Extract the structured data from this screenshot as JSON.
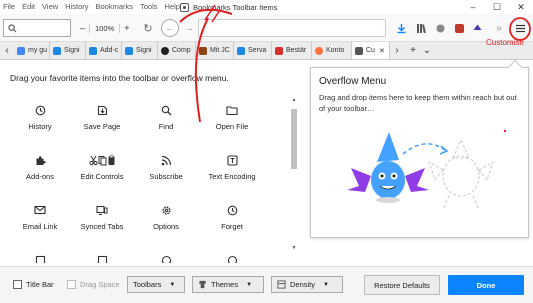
{
  "window": {
    "title": "Bookmarks Toolbar Items",
    "menu": [
      "File",
      "Edit",
      "View",
      "History",
      "Bookmarks",
      "Tools",
      "Help"
    ],
    "controls": [
      "–",
      "☐",
      "✕"
    ]
  },
  "toolbar": {
    "search_placeholder": "",
    "zoom_minus": "–",
    "zoom_value": "100%",
    "zoom_plus": "+",
    "reload": "↻"
  },
  "tabs": [
    {
      "label": "my gu",
      "color": "#4285f4"
    },
    {
      "label": "Signi",
      "color": "#1e88e5"
    },
    {
      "label": "Add-c",
      "color": "#1e88e5"
    },
    {
      "label": "Signi",
      "color": "#1e88e5"
    },
    {
      "label": "Comp",
      "color": "#222222"
    },
    {
      "label": "Mit JC",
      "color": "#8b4513"
    },
    {
      "label": "Serva",
      "color": "#1e88e5"
    },
    {
      "label": "Bestär",
      "color": "#d32f2f"
    },
    {
      "label": "Konto",
      "color": "#ff7043"
    },
    {
      "label": "Cu",
      "color": "#555555"
    }
  ],
  "customize": {
    "instruction": "Drag your favorite items into the toolbar or overflow menu.",
    "items": [
      {
        "label": "History",
        "icon": "clock-icon"
      },
      {
        "label": "Save Page",
        "icon": "save-page-icon"
      },
      {
        "label": "Find",
        "icon": "magnifier-icon"
      },
      {
        "label": "Open File",
        "icon": "folder-icon"
      },
      {
        "label": "Add-ons",
        "icon": "puzzle-icon"
      },
      {
        "label": "Edit Controls",
        "icon": "cut-copy-paste-icon"
      },
      {
        "label": "Subscribe",
        "icon": "rss-icon"
      },
      {
        "label": "Text Encoding",
        "icon": "text-encoding-icon"
      },
      {
        "label": "Email Link",
        "icon": "envelope-icon"
      },
      {
        "label": "Synced Tabs",
        "icon": "synced-tabs-icon"
      },
      {
        "label": "Options",
        "icon": "gear-icon"
      },
      {
        "label": "Forget",
        "icon": "forget-icon"
      }
    ]
  },
  "overflow": {
    "title": "Overflow Menu",
    "description": "Drag and drop items here to keep them within reach but out of your toolbar…"
  },
  "footer": {
    "title_bar": "Title Bar",
    "drag_space": "Drag Space",
    "toolbars": "Toolbars",
    "themes": "Themes",
    "density": "Density",
    "restore": "Restore Defaults",
    "done": "Done"
  },
  "annotation": {
    "label": "Customise",
    "color": "#e02020"
  }
}
